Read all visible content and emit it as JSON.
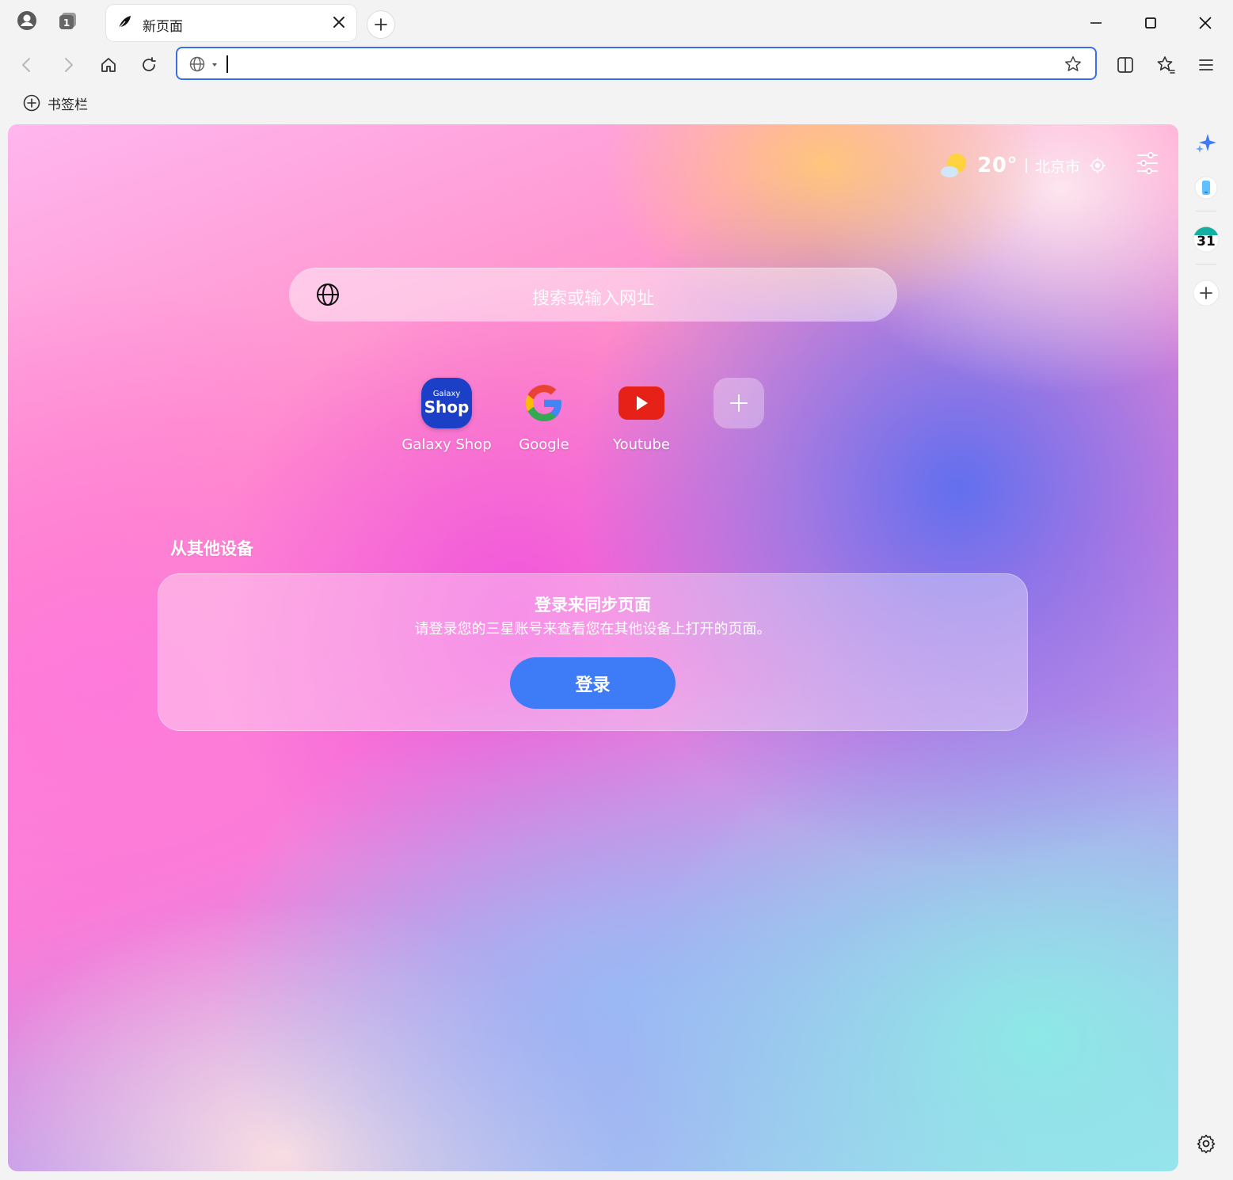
{
  "tab": {
    "title": "新页面"
  },
  "urlbar": {
    "value": ""
  },
  "bookmarks_bar": {
    "label": "书签栏"
  },
  "weather": {
    "temperature": "20°",
    "city": "北京市"
  },
  "search": {
    "placeholder": "搜索或输入网址"
  },
  "shortcuts": [
    {
      "label": "Galaxy Shop",
      "icon_text_top": "Galaxy",
      "icon_text_main": "Shop"
    },
    {
      "label": "Google"
    },
    {
      "label": "Youtube"
    }
  ],
  "sync": {
    "section_title": "从其他设备",
    "title": "登录来同步页面",
    "description": "请登录您的三星账号来查看您在其他设备上打开的页面。",
    "login_label": "登录"
  },
  "side_panel": {
    "calendar_day": "31"
  },
  "colors": {
    "accent": "#3d7cf6",
    "url_focus": "#3a6ee8"
  }
}
